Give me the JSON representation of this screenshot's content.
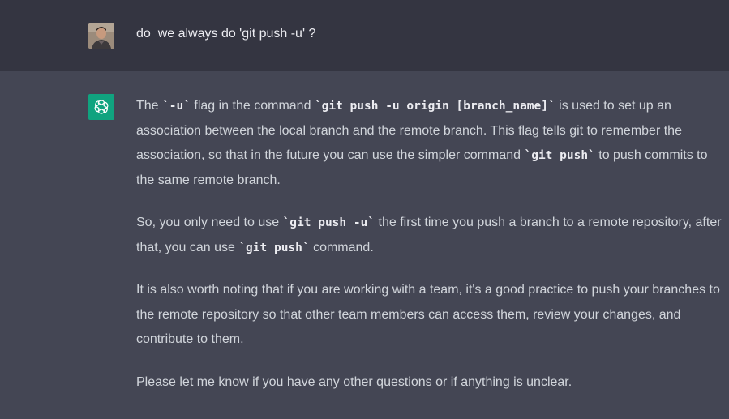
{
  "user_message": {
    "text": "do  we always do 'git push -u' ?"
  },
  "assistant_message": {
    "p1": {
      "t1": "The ",
      "c1": "`-u`",
      "t2": " flag in the command ",
      "c2": "`git push -u origin [branch_name]`",
      "t3": " is used to set up an association between the local branch and the remote branch. This flag tells git to remember the association, so that in the future you can use the simpler command ",
      "c3": "`git push`",
      "t4": " to push commits to the same remote branch."
    },
    "p2": {
      "t1": "So, you only need to use ",
      "c1": "`git push -u`",
      "t2": " the first time you push a branch to a remote repository, after that, you can use ",
      "c2": "`git push`",
      "t3": " command."
    },
    "p3": "It is also worth noting that if you are working with a team, it's a good practice to push your branches to the remote repository so that other team members can access them, review your changes, and contribute to them.",
    "p4": "Please let me know if you have any other questions or if anything is unclear."
  },
  "icons": {
    "user_avatar": "user-avatar-photo",
    "assistant_avatar": "openai-logo-icon"
  },
  "colors": {
    "user_row_bg": "#343541",
    "assistant_row_bg": "#444654",
    "avatar_green": "#10a37f"
  }
}
